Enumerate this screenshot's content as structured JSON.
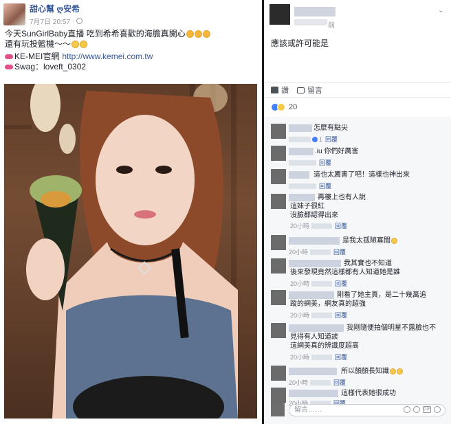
{
  "post": {
    "author": "甜心幫 ღ安希",
    "date": "7月7日 20:57",
    "date_sep": "·",
    "line1_text": "今天SunGirlBaby直播 吃到希希喜歡的海膽真開心",
    "line2_text": "還有玩投籃機～～",
    "site_label": "KE-MEI官網",
    "site_url": "http://www.kemei.com.tw",
    "swag_label": "Swag：loveft_0302"
  },
  "thread": {
    "top_comment_time_suffix": "前",
    "top_comment_body": "應該或許可能是",
    "chevron": "⌄",
    "actions": {
      "like": "讚",
      "comment": "留言"
    },
    "reaction_count": "20",
    "reply_label": "回覆",
    "like_count": "1",
    "comments": [
      {
        "text": "怎麼有點尖",
        "meta_prefix": "讚",
        "liked": true
      },
      {
        "text": ".iu 你們好厲害",
        "meta_prefix": "讚"
      },
      {
        "text": "這也太厲害了吧！這樣也神出來",
        "meta_prefix": "讚"
      },
      {
        "text": "再樓上也有人說",
        "line2": "這妹子很紅",
        "line3": "沒臉都認得出來",
        "meta_prefix": "20小時"
      },
      {
        "text": "是我太孤陋寡聞",
        "meta_prefix": "20小時",
        "emoji": true
      },
      {
        "text": "我其實也不知道",
        "line2": "後來發現竟然這樣都有人知道她是誰",
        "meta_prefix": "20小時"
      },
      {
        "text": "剛看了她主頁，是二十幾萬追",
        "line2": "蹤的網美，網友真的超強",
        "meta_prefix": "20小時"
      },
      {
        "text": "我剛隨便拍個明星不露臉也不",
        "line2": "見得有人知道誒",
        "line3": "這網美真的辨識度超高",
        "meta_prefix": "20小時"
      },
      {
        "text": "所以顏顏長知識",
        "meta_prefix": "20小時",
        "emoji": true
      },
      {
        "text": "這樣代表她很成功",
        "meta_prefix": "20小時"
      }
    ],
    "input_placeholder": "留言……",
    "input_icons": [
      "emoji-icon",
      "camera-icon",
      "gif-icon",
      "sticker-icon"
    ],
    "gif_label": "GIF"
  },
  "colors": {
    "link": "#365899",
    "meta": "#90949c",
    "like_blue": "#4080ff"
  }
}
